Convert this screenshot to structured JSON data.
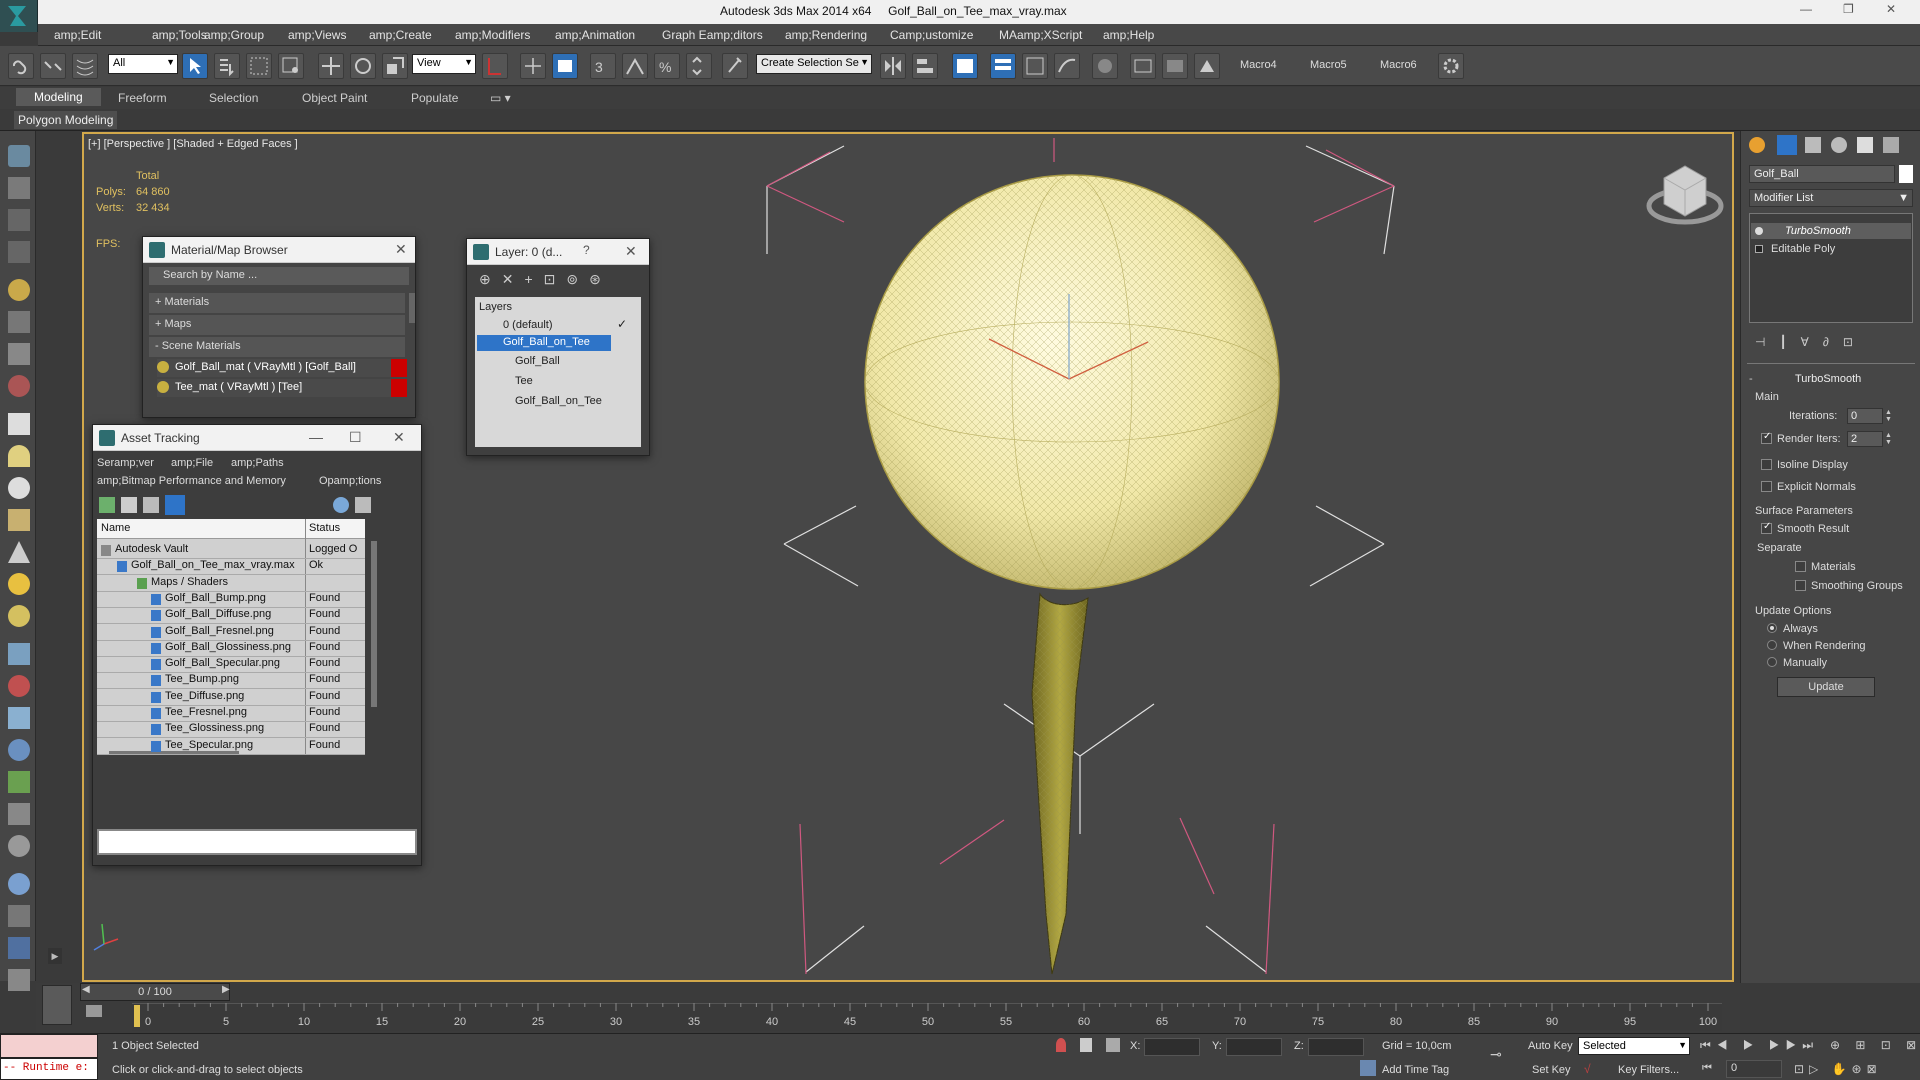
{
  "window": {
    "app_title": "Autodesk 3ds Max  2014 x64",
    "file_title": "Golf_Ball_on_Tee_max_vray.max"
  },
  "menu": [
    "amp;Edit",
    "amp;Tools",
    "amp;Group",
    "amp;Views",
    "amp;Create",
    "amp;Modifiers",
    "amp;Animation",
    "Graph Eamp;ditors",
    "amp;Rendering",
    "Camp;ustomize",
    "MAamp;XScript",
    "amp;Help"
  ],
  "toolbar": {
    "filter": "All",
    "ref_coord": "View",
    "selection_set": "Create Selection Se",
    "macros": [
      "Macro4",
      "Macro5",
      "Macro6"
    ]
  },
  "ribbon": {
    "tabs": [
      "Modeling",
      "Freeform",
      "Selection",
      "Object Paint",
      "Populate"
    ],
    "sub": "Polygon Modeling"
  },
  "viewport": {
    "label": "[+] [Perspective ] [Shaded + Edged Faces ]",
    "stats_header": "Total",
    "polys_label": "Polys:",
    "polys_value": "64 860",
    "verts_label": "Verts:",
    "verts_value": "32 434",
    "fps_label": "FPS:"
  },
  "material_browser": {
    "title": "Material/Map Browser",
    "search": "Search by Name ...",
    "groups": [
      "+ Materials",
      "+ Maps",
      "- Scene Materials"
    ],
    "items": [
      "Golf_Ball_mat  ( VRayMtl ) [Golf_Ball]",
      "Tee_mat  ( VRayMtl ) [Tee]"
    ]
  },
  "layer_window": {
    "title": "Layer: 0 (d...",
    "help": "?",
    "header": "Layers",
    "rows": [
      "0 (default)",
      "Golf_Ball_on_Tee",
      "Golf_Ball",
      "Tee",
      "Golf_Ball_on_Tee"
    ]
  },
  "asset_tracking": {
    "title": "Asset Tracking",
    "menu": [
      "Seramp;ver",
      "amp;File",
      "amp;Paths",
      "amp;Bitmap Performance and Memory",
      "Opamp;tions"
    ],
    "col_name": "Name",
    "col_status": "Status",
    "rows": [
      {
        "name": "Autodesk Vault",
        "status": "Logged O"
      },
      {
        "name": "Golf_Ball_on_Tee_max_vray.max",
        "status": "Ok"
      },
      {
        "name": "Maps / Shaders",
        "status": ""
      },
      {
        "name": "Golf_Ball_Bump.png",
        "status": "Found"
      },
      {
        "name": "Golf_Ball_Diffuse.png",
        "status": "Found"
      },
      {
        "name": "Golf_Ball_Fresnel.png",
        "status": "Found"
      },
      {
        "name": "Golf_Ball_Glossiness.png",
        "status": "Found"
      },
      {
        "name": "Golf_Ball_Specular.png",
        "status": "Found"
      },
      {
        "name": "Tee_Bump.png",
        "status": "Found"
      },
      {
        "name": "Tee_Diffuse.png",
        "status": "Found"
      },
      {
        "name": "Tee_Fresnel.png",
        "status": "Found"
      },
      {
        "name": "Tee_Glossiness.png",
        "status": "Found"
      },
      {
        "name": "Tee_Specular.png",
        "status": "Found"
      }
    ]
  },
  "command_panel": {
    "object_name": "Golf_Ball",
    "modifier_list": "Modifier List",
    "stack": [
      "TurboSmooth",
      "Editable Poly"
    ],
    "rollout": "TurboSmooth",
    "main": "Main",
    "iterations_label": "Iterations:",
    "iterations": "0",
    "render_iters_label": "Render Iters:",
    "render_iters": "2",
    "isoline": "Isoline Display",
    "explicit": "Explicit Normals",
    "surface": "Surface Parameters",
    "smooth": "Smooth Result",
    "separate": "Separate",
    "materials": "Materials",
    "smoothing": "Smoothing Groups",
    "update_options": "Update Options",
    "always": "Always",
    "when_rendering": "When Rendering",
    "manually": "Manually",
    "update": "Update"
  },
  "timeline": {
    "frame": "0 / 100",
    "ticks": [
      "0",
      "5",
      "10",
      "15",
      "20",
      "25",
      "30",
      "35",
      "40",
      "45",
      "50",
      "55",
      "60",
      "65",
      "70",
      "75",
      "80",
      "85",
      "90",
      "95",
      "100"
    ]
  },
  "status": {
    "runtime": "-- Runtime e:",
    "selected": "1 Object Selected",
    "prompt": "Click or click-and-drag to select objects",
    "x": "X:",
    "y": "Y:",
    "z": "Z:",
    "grid": "Grid = 10,0cm",
    "auto_key": "Auto Key",
    "set_key": "Set Key",
    "selected_dd": "Selected",
    "key_filters": "Key Filters...",
    "add_time_tag": "Add Time Tag",
    "frame_value": "0"
  }
}
